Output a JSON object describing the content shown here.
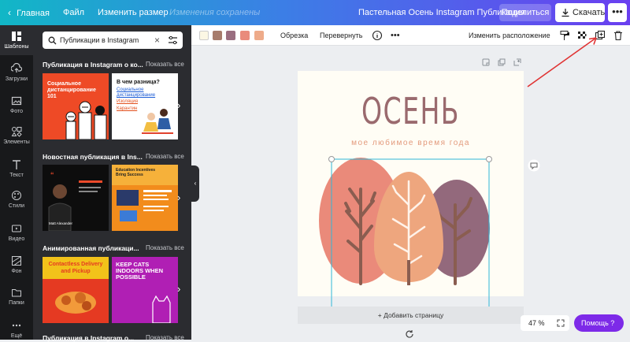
{
  "topbar": {
    "home": "Главная",
    "file": "Файл",
    "resize": "Изменить размер",
    "saved_status": "Изменения сохранены",
    "doc_title": "Пастельная Осень Instagram Публикация",
    "share": "Поделиться",
    "download": "Скачать",
    "more": "•••"
  },
  "rail": [
    {
      "label": "Шаблоны",
      "icon": "templates-icon"
    },
    {
      "label": "Загрузки",
      "icon": "upload-icon"
    },
    {
      "label": "Фото",
      "icon": "photo-icon"
    },
    {
      "label": "Элементы",
      "icon": "elements-icon"
    },
    {
      "label": "Текст",
      "icon": "text-icon"
    },
    {
      "label": "Стили",
      "icon": "styles-icon"
    },
    {
      "label": "Видео",
      "icon": "video-icon"
    },
    {
      "label": "Фон",
      "icon": "background-icon"
    },
    {
      "label": "Папки",
      "icon": "folder-icon"
    },
    {
      "label": "Ещё",
      "icon": "more-icon"
    }
  ],
  "panel": {
    "search_value": "Публикации в Instagram",
    "sections": [
      {
        "title": "Публикация в Instagram о ко...",
        "show_all": "Показать все"
      },
      {
        "title": "Новостная публикация в Ins...",
        "show_all": "Показать все"
      },
      {
        "title": "Анимированная публикаци...",
        "show_all": "Показать все"
      },
      {
        "title": "Публикация в Instagram о...",
        "show_all": "Показать все"
      }
    ],
    "thumbs": {
      "t1_text": "Социальное дистанцирование 101",
      "t2_title": "В чем разница?",
      "t2_items": [
        "Социальное дистанцирование",
        "Изоляция",
        "Карантин"
      ],
      "t3_text": "Matt Alexander",
      "t4_text": "Education Incentives Bring Success",
      "t5_text": "Contactless Delivery and Pickup",
      "t6_text": "KEEP CATS INDOORS WHEN POSSIBLE"
    }
  },
  "toolbar": {
    "colors": [
      "#fbf7e4",
      "#a77c6c",
      "#9a6e80",
      "#e98b7c",
      "#eeab8a"
    ],
    "crop": "Обрезка",
    "flip": "Перевернуть",
    "more": "•••",
    "arrange": "Изменить расположение"
  },
  "canvas": {
    "title": "ОСЕНЬ",
    "subtitle": "мое любимое время года",
    "add_page": "+ Добавить страницу",
    "zoom": "47 %",
    "help": "Помощь  ?"
  }
}
